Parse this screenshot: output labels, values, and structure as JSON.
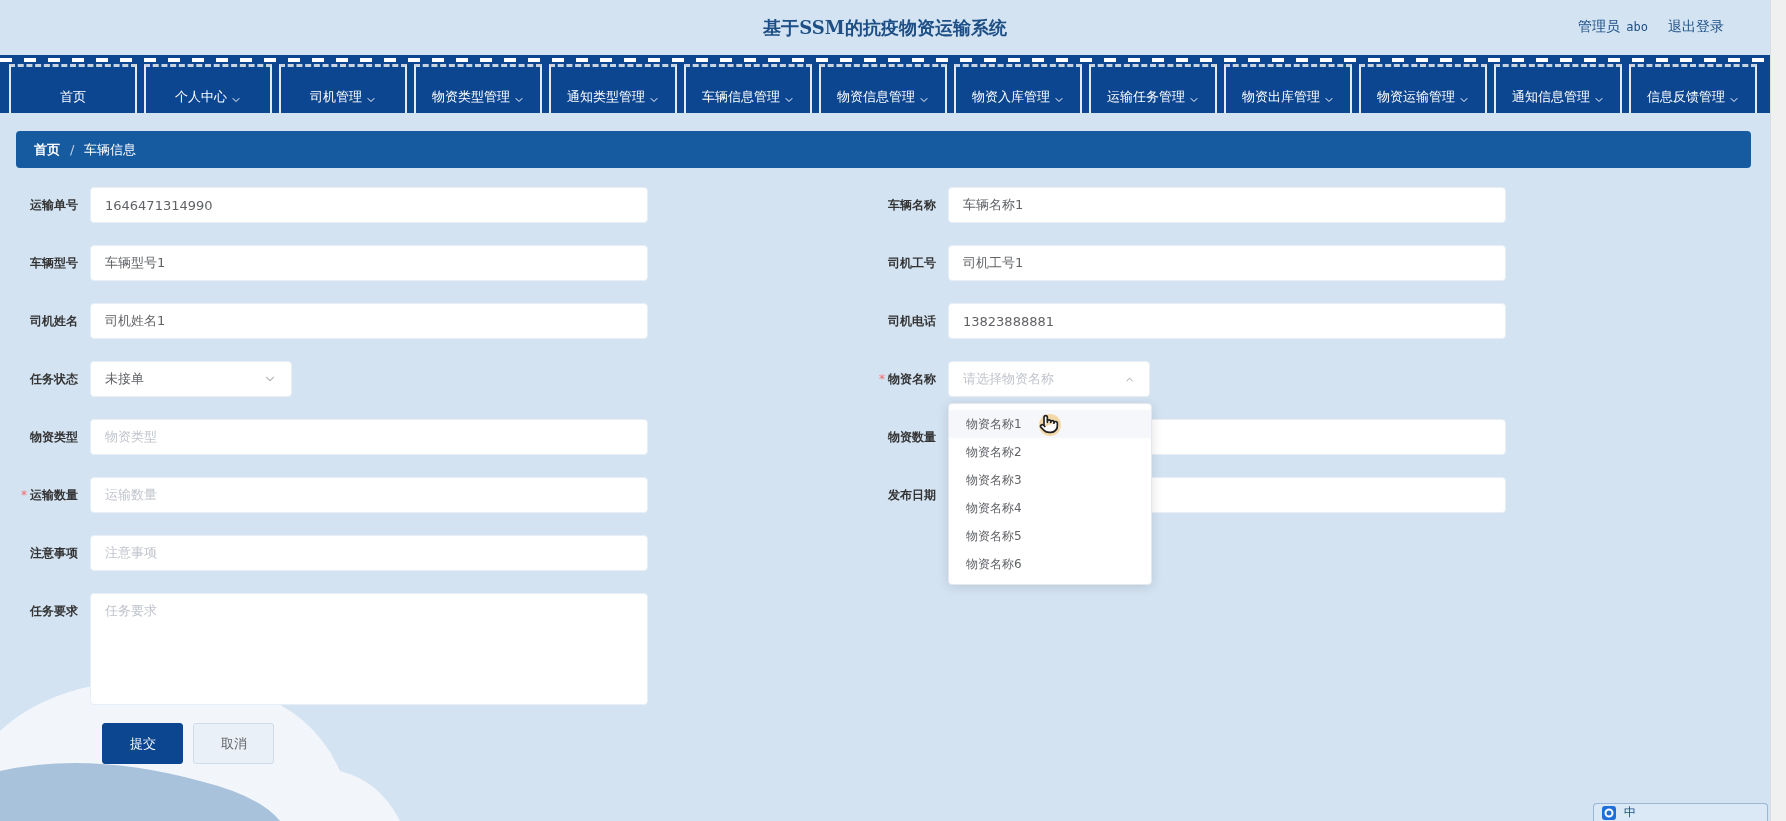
{
  "header": {
    "title": "基于SSM的抗疫物资运输系统",
    "user_role": "管理员",
    "username": "abo",
    "logout": "退出登录"
  },
  "nav": [
    {
      "label": "首页",
      "has_menu": false
    },
    {
      "label": "个人中心",
      "has_menu": true
    },
    {
      "label": "司机管理",
      "has_menu": true
    },
    {
      "label": "物资类型管理",
      "has_menu": true
    },
    {
      "label": "通知类型管理",
      "has_menu": true
    },
    {
      "label": "车辆信息管理",
      "has_menu": true
    },
    {
      "label": "物资信息管理",
      "has_menu": true
    },
    {
      "label": "物资入库管理",
      "has_menu": true
    },
    {
      "label": "运输任务管理",
      "has_menu": true
    },
    {
      "label": "物资出库管理",
      "has_menu": true
    },
    {
      "label": "物资运输管理",
      "has_menu": true
    },
    {
      "label": "通知信息管理",
      "has_menu": true
    },
    {
      "label": "信息反馈管理",
      "has_menu": true
    }
  ],
  "breadcrumb": {
    "separator": "/",
    "items": [
      {
        "label": "首页",
        "current": false
      },
      {
        "label": "车辆信息",
        "current": true
      }
    ]
  },
  "form": {
    "required_mark": "*",
    "rows": [
      {
        "left": {
          "kind": "input",
          "label": "运输单号",
          "value": "1646471314990",
          "required": false
        },
        "right": {
          "kind": "input",
          "label": "车辆名称",
          "value": "车辆名称1",
          "required": false
        }
      },
      {
        "left": {
          "kind": "input",
          "label": "车辆型号",
          "value": "车辆型号1",
          "required": false
        },
        "right": {
          "kind": "input",
          "label": "司机工号",
          "value": "司机工号1",
          "required": false
        }
      },
      {
        "left": {
          "kind": "input",
          "label": "司机姓名",
          "value": "司机姓名1",
          "required": false
        },
        "right": {
          "kind": "input",
          "label": "司机电话",
          "value": "13823888881",
          "required": false
        }
      },
      {
        "left": {
          "kind": "select",
          "label": "任务状态",
          "value": "未接单",
          "required": false,
          "expanded": false
        },
        "right": {
          "kind": "select",
          "label": "物资名称",
          "placeholder": "请选择物资名称",
          "required": true,
          "expanded": true,
          "options": [
            {
              "label": "物资名称1",
              "highlighted": true
            },
            {
              "label": "物资名称2",
              "highlighted": false
            },
            {
              "label": "物资名称3",
              "highlighted": false
            },
            {
              "label": "物资名称4",
              "highlighted": false
            },
            {
              "label": "物资名称5",
              "highlighted": false
            },
            {
              "label": "物资名称6",
              "highlighted": false
            }
          ]
        }
      },
      {
        "left": {
          "kind": "input",
          "label": "物资类型",
          "placeholder": "物资类型",
          "required": false
        },
        "right": {
          "kind": "input",
          "label": "物资数量",
          "required": false
        }
      },
      {
        "left": {
          "kind": "input",
          "label": "运输数量",
          "placeholder": "运输数量",
          "required": true
        },
        "right": {
          "kind": "date",
          "label": "发布日期",
          "required": false
        }
      },
      {
        "left": {
          "kind": "input",
          "label": "注意事项",
          "placeholder": "注意事项",
          "required": false
        }
      },
      {
        "left": {
          "kind": "textarea",
          "label": "任务要求",
          "placeholder": "任务要求",
          "required": false
        }
      }
    ],
    "buttons": [
      {
        "label": "提交",
        "kind": "primary"
      },
      {
        "label": "取消",
        "kind": "default"
      }
    ]
  },
  "ime_toolbar": {
    "mode": "中"
  }
}
